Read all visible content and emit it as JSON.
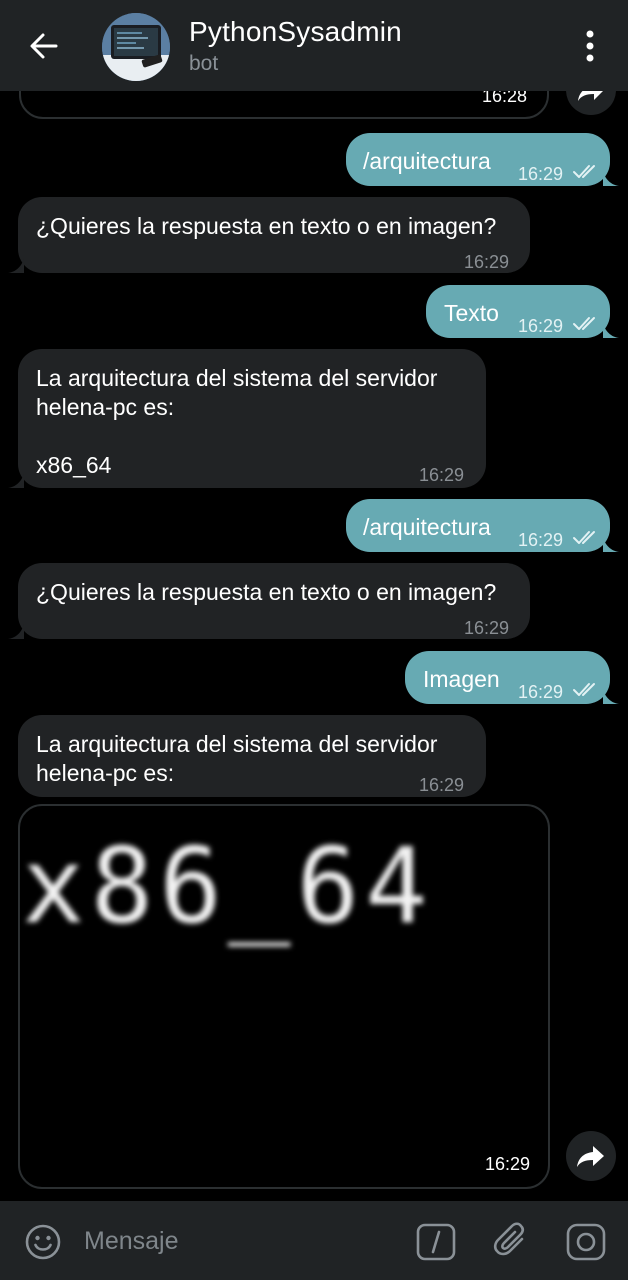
{
  "header": {
    "title": "PythonSysadmin",
    "subtitle": "bot"
  },
  "messages": [
    {
      "id": "prev",
      "direction": "in",
      "time": "16:28"
    },
    {
      "id": "m1",
      "direction": "out",
      "text": "/arquitectura",
      "time": "16:29"
    },
    {
      "id": "m2",
      "direction": "in",
      "text": "¿Quieres la respuesta en texto o en imagen?",
      "time": "16:29"
    },
    {
      "id": "m3",
      "direction": "out",
      "text": "Texto",
      "time": "16:29"
    },
    {
      "id": "m4",
      "direction": "in",
      "text": "La arquitectura del sistema del servidor\nhelena-pc es:\n\nx86_64",
      "time": "16:29"
    },
    {
      "id": "m5",
      "direction": "out",
      "text": "/arquitectura",
      "time": "16:29"
    },
    {
      "id": "m6",
      "direction": "in",
      "text": "¿Quieres la respuesta en texto o en imagen?",
      "time": "16:29"
    },
    {
      "id": "m7",
      "direction": "out",
      "text": "Imagen",
      "time": "16:29"
    },
    {
      "id": "m8",
      "direction": "in",
      "text": "La arquitectura del sistema del servidor\nhelena-pc es:",
      "time": "16:29"
    },
    {
      "id": "m9",
      "direction": "in",
      "image_text": "x86_64",
      "time": "16:29"
    }
  ],
  "input": {
    "placeholder": "Mensaje"
  },
  "colors": {
    "header_bg": "#202325",
    "incoming_bubble": "#212325",
    "outgoing_bubble": "#67aab3",
    "chat_bg": "#000000"
  },
  "icons": {
    "back": "arrow-left-icon",
    "menu": "more-vertical-icon",
    "share": "forward-icon",
    "emoji": "emoji-icon",
    "command": "slash-command-icon",
    "attach": "paperclip-icon",
    "camera": "camera-icon"
  }
}
